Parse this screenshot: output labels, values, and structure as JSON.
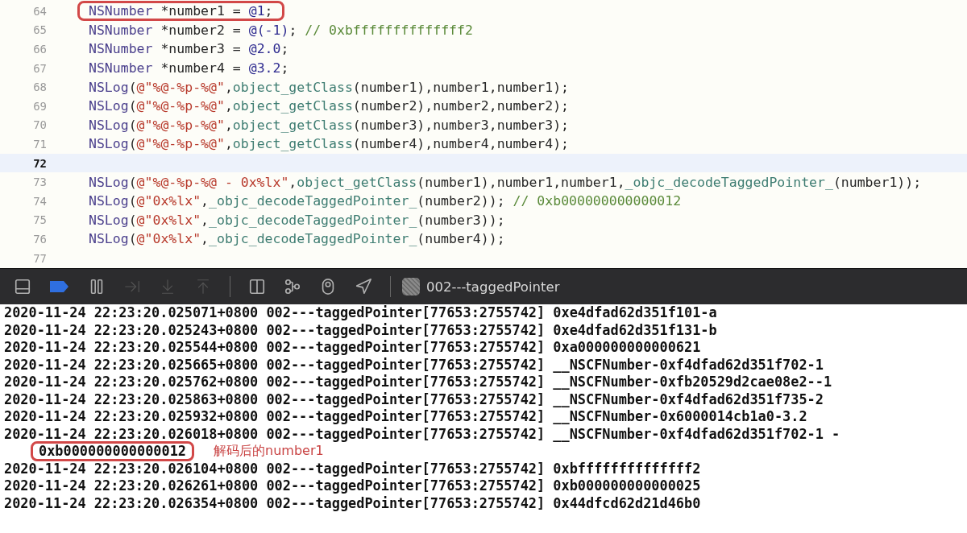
{
  "code_editor": {
    "lines": [
      {
        "number": "64",
        "boxed": true,
        "current": false,
        "tokens": [
          {
            "kind": "type",
            "text": "NSNumber"
          },
          {
            "kind": "plain",
            "text": " *number1 = "
          },
          {
            "kind": "number",
            "text": "@1"
          },
          {
            "kind": "plain",
            "text": ";"
          }
        ]
      },
      {
        "number": "65",
        "boxed": false,
        "current": false,
        "tokens": [
          {
            "kind": "type",
            "text": "NSNumber"
          },
          {
            "kind": "plain",
            "text": " *number2 = "
          },
          {
            "kind": "number",
            "text": "@(-1)"
          },
          {
            "kind": "plain",
            "text": "; "
          },
          {
            "kind": "comment",
            "text": "// 0xbffffffffffffff2"
          }
        ]
      },
      {
        "number": "66",
        "boxed": false,
        "current": false,
        "tokens": [
          {
            "kind": "type",
            "text": "NSNumber"
          },
          {
            "kind": "plain",
            "text": " *number3 = "
          },
          {
            "kind": "number",
            "text": "@2.0"
          },
          {
            "kind": "plain",
            "text": ";"
          }
        ]
      },
      {
        "number": "67",
        "boxed": false,
        "current": false,
        "tokens": [
          {
            "kind": "type",
            "text": "NSNumber"
          },
          {
            "kind": "plain",
            "text": " *number4 = "
          },
          {
            "kind": "number",
            "text": "@3.2"
          },
          {
            "kind": "plain",
            "text": ";"
          }
        ]
      },
      {
        "number": "68",
        "boxed": false,
        "current": false,
        "tokens": [
          {
            "kind": "type",
            "text": "NSLog"
          },
          {
            "kind": "plain",
            "text": "("
          },
          {
            "kind": "string",
            "text": "@\"%@-%p-%@\""
          },
          {
            "kind": "plain",
            "text": ","
          },
          {
            "kind": "function",
            "text": "object_getClass"
          },
          {
            "kind": "plain",
            "text": "(number1),number1,number1);"
          }
        ]
      },
      {
        "number": "69",
        "boxed": false,
        "current": false,
        "tokens": [
          {
            "kind": "type",
            "text": "NSLog"
          },
          {
            "kind": "plain",
            "text": "("
          },
          {
            "kind": "string",
            "text": "@\"%@-%p-%@\""
          },
          {
            "kind": "plain",
            "text": ","
          },
          {
            "kind": "function",
            "text": "object_getClass"
          },
          {
            "kind": "plain",
            "text": "(number2),number2,number2);"
          }
        ]
      },
      {
        "number": "70",
        "boxed": false,
        "current": false,
        "tokens": [
          {
            "kind": "type",
            "text": "NSLog"
          },
          {
            "kind": "plain",
            "text": "("
          },
          {
            "kind": "string",
            "text": "@\"%@-%p-%@\""
          },
          {
            "kind": "plain",
            "text": ","
          },
          {
            "kind": "function",
            "text": "object_getClass"
          },
          {
            "kind": "plain",
            "text": "(number3),number3,number3);"
          }
        ]
      },
      {
        "number": "71",
        "boxed": false,
        "current": false,
        "tokens": [
          {
            "kind": "type",
            "text": "NSLog"
          },
          {
            "kind": "plain",
            "text": "("
          },
          {
            "kind": "string",
            "text": "@\"%@-%p-%@\""
          },
          {
            "kind": "plain",
            "text": ","
          },
          {
            "kind": "function",
            "text": "object_getClass"
          },
          {
            "kind": "plain",
            "text": "(number4),number4,number4);"
          }
        ]
      },
      {
        "number": "72",
        "boxed": false,
        "current": true
      },
      {
        "number": "73",
        "boxed": false,
        "current": false,
        "tokens": [
          {
            "kind": "type",
            "text": "NSLog"
          },
          {
            "kind": "plain",
            "text": "("
          },
          {
            "kind": "string",
            "text": "@\"%@-%p-%@ - 0x%lx\""
          },
          {
            "kind": "plain",
            "text": ","
          },
          {
            "kind": "function",
            "text": "object_getClass"
          },
          {
            "kind": "plain",
            "text": "(number1),number1,number1,"
          },
          {
            "kind": "function",
            "text": "_objc_decodeTaggedPointer_"
          },
          {
            "kind": "plain",
            "text": "(number1));"
          }
        ]
      },
      {
        "number": "74",
        "boxed": false,
        "current": false,
        "tokens": [
          {
            "kind": "type",
            "text": "NSLog"
          },
          {
            "kind": "plain",
            "text": "("
          },
          {
            "kind": "string",
            "text": "@\"0x%lx\""
          },
          {
            "kind": "plain",
            "text": ","
          },
          {
            "kind": "function",
            "text": "_objc_decodeTaggedPointer_"
          },
          {
            "kind": "plain",
            "text": "(number2)); "
          },
          {
            "kind": "comment",
            "text": "// 0xb000000000000012"
          }
        ]
      },
      {
        "number": "75",
        "boxed": false,
        "current": false,
        "tokens": [
          {
            "kind": "type",
            "text": "NSLog"
          },
          {
            "kind": "plain",
            "text": "("
          },
          {
            "kind": "string",
            "text": "@\"0x%lx\""
          },
          {
            "kind": "plain",
            "text": ","
          },
          {
            "kind": "function",
            "text": "_objc_decodeTaggedPointer_"
          },
          {
            "kind": "plain",
            "text": "(number3));"
          }
        ]
      },
      {
        "number": "76",
        "boxed": false,
        "current": false,
        "tokens": [
          {
            "kind": "type",
            "text": "NSLog"
          },
          {
            "kind": "plain",
            "text": "("
          },
          {
            "kind": "string",
            "text": "@\"0x%lx\""
          },
          {
            "kind": "plain",
            "text": ","
          },
          {
            "kind": "function",
            "text": "_objc_decodeTaggedPointer_"
          },
          {
            "kind": "plain",
            "text": "(number4));"
          }
        ]
      },
      {
        "number": "77",
        "boxed": false,
        "current": false
      }
    ]
  },
  "debug_bar": {
    "groups": [
      [
        {
          "kind": "panel",
          "active": false,
          "disabled": false
        },
        {
          "kind": "breakpoints",
          "active": true,
          "disabled": false
        },
        {
          "kind": "pause",
          "active": false,
          "disabled": false
        },
        {
          "kind": "step_over",
          "active": false,
          "disabled": true
        },
        {
          "kind": "step_into",
          "active": false,
          "disabled": true
        },
        {
          "kind": "step_out",
          "active": false,
          "disabled": true
        }
      ],
      [
        {
          "kind": "view_debugger",
          "active": false,
          "disabled": false
        },
        {
          "kind": "memory_graph",
          "active": false,
          "disabled": false
        },
        {
          "kind": "environment",
          "active": false,
          "disabled": false
        },
        {
          "kind": "location",
          "active": false,
          "disabled": false
        }
      ]
    ],
    "target": "002---taggedPointer"
  },
  "console": {
    "lines": [
      {
        "kind": "log",
        "text": "2020-11-24 22:23:20.025071+0800 002---taggedPointer[77653:2755742] 0xe4dfad62d351f101-a"
      },
      {
        "kind": "log",
        "text": "2020-11-24 22:23:20.025243+0800 002---taggedPointer[77653:2755742] 0xe4dfad62d351f131-b"
      },
      {
        "kind": "log",
        "text": "2020-11-24 22:23:20.025544+0800 002---taggedPointer[77653:2755742] 0xa000000000000621"
      },
      {
        "kind": "log",
        "text": "2020-11-24 22:23:20.025665+0800 002---taggedPointer[77653:2755742] __NSCFNumber-0xf4dfad62d351f702-1"
      },
      {
        "kind": "log",
        "text": "2020-11-24 22:23:20.025762+0800 002---taggedPointer[77653:2755742] __NSCFNumber-0xfb20529d2cae08e2--1"
      },
      {
        "kind": "log",
        "text": "2020-11-24 22:23:20.025863+0800 002---taggedPointer[77653:2755742] __NSCFNumber-0xf4dfad62d351f735-2"
      },
      {
        "kind": "log",
        "text": "2020-11-24 22:23:20.025932+0800 002---taggedPointer[77653:2755742] __NSCFNumber-0x6000014cb1a0-3.2"
      },
      {
        "kind": "log",
        "text": "2020-11-24 22:23:20.026018+0800 002---taggedPointer[77653:2755742] __NSCFNumber-0xf4dfad62d351f702-1 -"
      },
      {
        "kind": "wrapped",
        "text": "0xb000000000000012",
        "note": "解码后的number1"
      },
      {
        "kind": "log",
        "text": "2020-11-24 22:23:20.026104+0800 002---taggedPointer[77653:2755742] 0xbffffffffffffff2"
      },
      {
        "kind": "log",
        "text": "2020-11-24 22:23:20.026261+0800 002---taggedPointer[77653:2755742] 0xb000000000000025"
      },
      {
        "kind": "log",
        "text": "2020-11-24 22:23:20.026354+0800 002---taggedPointer[77653:2755742] 0x44dfcd62d21d46b0"
      }
    ]
  }
}
